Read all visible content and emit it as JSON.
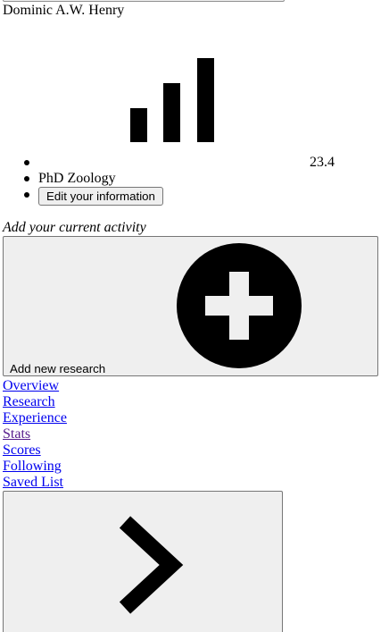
{
  "profile": {
    "name": "Dominic A.W. Henry",
    "score": "23.4",
    "degree": "PhD Zoology",
    "edit_label": "Edit your information"
  },
  "activity": {
    "prompt": "Add your current activity",
    "add_research_label": "Add new research"
  },
  "nav": {
    "items": [
      {
        "label": "Overview"
      },
      {
        "label": "Research"
      },
      {
        "label": "Experience"
      },
      {
        "label": "Stats"
      },
      {
        "label": "Scores"
      },
      {
        "label": "Following"
      },
      {
        "label": "Saved List"
      }
    ]
  },
  "icons": {
    "stats": "bar-chart-icon",
    "add": "plus-circle-icon",
    "next": "chevron-right-icon"
  },
  "colors": {
    "link": "#0000ee",
    "visited_link": "#551a8b",
    "button_bg": "#efefef"
  }
}
